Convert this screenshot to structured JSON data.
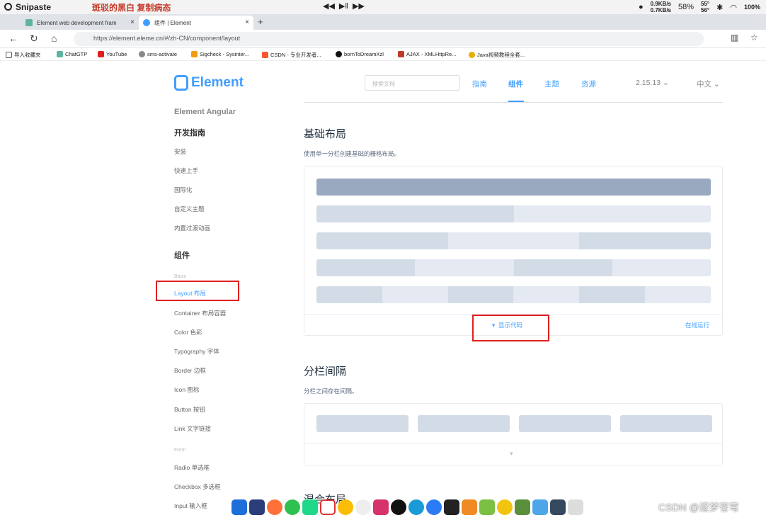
{
  "os_bar": {
    "app_name": "Snipaste",
    "center_title": "斑驳的黑白 复制病态",
    "network_up": "0.9KB/s",
    "network_down": "0.7KB/s",
    "memory": "58%",
    "temp_a": "55°",
    "temp_b": "56°",
    "battery": "100%"
  },
  "browser": {
    "tabs": [
      {
        "label": "Element web development fram",
        "close": "×"
      },
      {
        "label": "组件 | Element",
        "close": "×"
      }
    ],
    "new_tab": "+",
    "url": "https://element.eleme.cn/#/zh-CN/component/layout",
    "bookmarks": [
      "导入收藏夹",
      "ChatGTP",
      "YouTube",
      "sms-activate",
      "Sigcheck - Sysinter...",
      "CSDN - 专业开发者...",
      "bornToDreamXzl",
      "AJAX - XMLHttpRe...",
      "Java视频教程全套..."
    ]
  },
  "header": {
    "logo": "Element",
    "search_placeholder": "搜索文档",
    "nav": [
      "指南",
      "组件",
      "主题",
      "资源"
    ],
    "version": "2.15.13",
    "language": "中文"
  },
  "sidebar": {
    "angular": "Element Angular",
    "guide_heading": "开发指南",
    "guide_items": [
      "安装",
      "快速上手",
      "国际化",
      "自定义主题",
      "内置过渡动画"
    ],
    "components_heading": "组件",
    "basic_group": "Basic",
    "basic_items": [
      "Layout 布局",
      "Container 布局容器",
      "Color 色彩",
      "Typography 字体",
      "Border 边框",
      "Icon 图标",
      "Button 按钮",
      "Link 文字链接"
    ],
    "form_group": "Form",
    "form_items": [
      "Radio 单选框",
      "Checkbox 多选框",
      "Input 输入框"
    ]
  },
  "main": {
    "section1_title": "基础布局",
    "section1_desc": "使用单一分栏创建基础的栅格布局。",
    "show_code": "显示代码",
    "run_online": "在线运行",
    "section2_title": "分栏间隔",
    "section2_desc": "分栏之间存在间隔。",
    "section3_title": "混合布局"
  },
  "watermark": "CSDN @逐梦苍穹"
}
